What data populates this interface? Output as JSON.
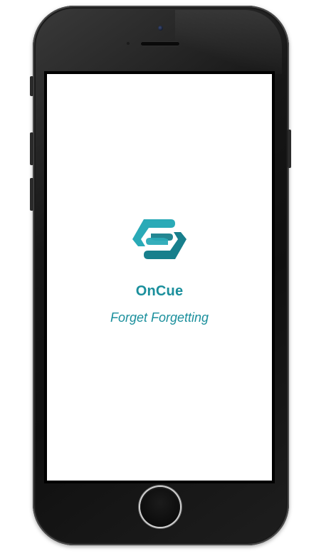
{
  "app": {
    "name": "OnCue",
    "tagline": "Forget Forgetting"
  },
  "colors": {
    "brand_teal": "#1a8f9c",
    "logo_light": "#2aaab7",
    "logo_dark": "#177f8c",
    "screen_background": "#ffffff",
    "device_body": "#161616"
  },
  "icons": {
    "logo": "oncue-hexagon-logo-icon",
    "home": "home-button",
    "camera": "front-camera-icon",
    "speaker": "earpiece-speaker-icon"
  }
}
